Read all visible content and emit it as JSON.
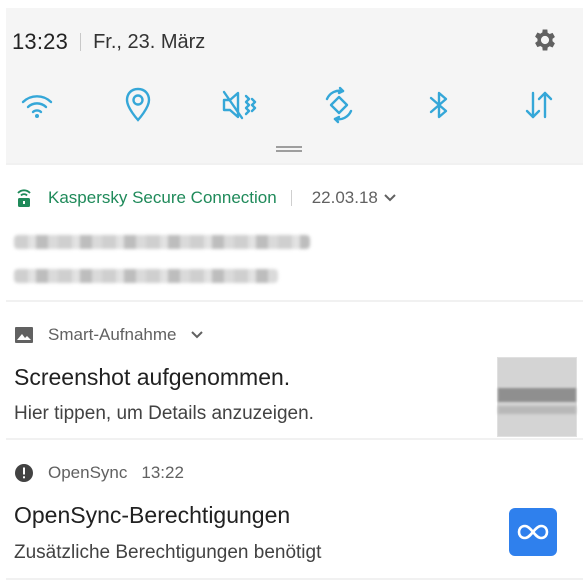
{
  "status": {
    "time": "13:23",
    "date": "Fr., 23. März"
  },
  "header_icons": {
    "settings": "gear-icon"
  },
  "quick_settings": [
    {
      "id": "wifi",
      "icon": "wifi-icon"
    },
    {
      "id": "location",
      "icon": "location-icon"
    },
    {
      "id": "sound",
      "icon": "mute-vibrate-icon"
    },
    {
      "id": "autorotate",
      "icon": "autorotate-icon"
    },
    {
      "id": "bluetooth",
      "icon": "bluetooth-icon"
    },
    {
      "id": "mobile-data",
      "icon": "mobile-data-icon"
    }
  ],
  "colors": {
    "accent": "#35a7d8",
    "kaspersky_green": "#1f8a5a",
    "opensync_blue": "#2f80ed"
  },
  "notifications": [
    {
      "app": "Kaspersky Secure Connection",
      "time": "22.03.18",
      "icon": "kaspersky-lock-icon"
    },
    {
      "app": "Smart-Aufnahme",
      "icon": "image-icon",
      "title": "Screenshot aufgenommen.",
      "text": "Hier tippen, um Details anzuzeigen."
    },
    {
      "app": "OpenSync",
      "time": "13:22",
      "icon": "alert-icon",
      "title": "OpenSync-Berechtigungen",
      "text": "Zusätzliche Berechtigungen benötigt",
      "app_icon": "opensync-icon"
    }
  ]
}
